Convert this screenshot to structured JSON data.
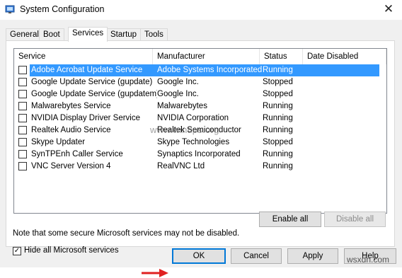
{
  "window": {
    "title": "System Configuration",
    "close_glyph": "✕"
  },
  "tabs": [
    {
      "label": "General"
    },
    {
      "label": "Boot"
    },
    {
      "label": "Services"
    },
    {
      "label": "Startup"
    },
    {
      "label": "Tools"
    }
  ],
  "active_tab": "Services",
  "table": {
    "headers": {
      "service": "Service",
      "manufacturer": "Manufacturer",
      "status": "Status",
      "date_disabled": "Date Disabled"
    },
    "rows": [
      {
        "service": "Adobe Acrobat Update Service",
        "manufacturer": "Adobe Systems Incorporated",
        "status": "Running",
        "date_disabled": "",
        "checked": false,
        "selected": true
      },
      {
        "service": "Google Update Service (gupdate)",
        "manufacturer": "Google Inc.",
        "status": "Stopped",
        "date_disabled": "",
        "checked": false,
        "selected": false
      },
      {
        "service": "Google Update Service (gupdatem)",
        "manufacturer": "Google Inc.",
        "status": "Stopped",
        "date_disabled": "",
        "checked": false,
        "selected": false
      },
      {
        "service": "Malwarebytes Service",
        "manufacturer": "Malwarebytes",
        "status": "Running",
        "date_disabled": "",
        "checked": false,
        "selected": false
      },
      {
        "service": "NVIDIA Display Driver Service",
        "manufacturer": "NVIDIA Corporation",
        "status": "Running",
        "date_disabled": "",
        "checked": false,
        "selected": false
      },
      {
        "service": "Realtek Audio Service",
        "manufacturer": "Realtek Semiconductor",
        "status": "Running",
        "date_disabled": "",
        "checked": false,
        "selected": false
      },
      {
        "service": "Skype Updater",
        "manufacturer": "Skype Technologies",
        "status": "Stopped",
        "date_disabled": "",
        "checked": false,
        "selected": false
      },
      {
        "service": "SynTPEnh Caller Service",
        "manufacturer": "Synaptics Incorporated",
        "status": "Running",
        "date_disabled": "",
        "checked": false,
        "selected": false
      },
      {
        "service": "VNC Server Version 4",
        "manufacturer": "RealVNC Ltd",
        "status": "Running",
        "date_disabled": "",
        "checked": false,
        "selected": false
      }
    ]
  },
  "note": "Note that some secure Microsoft services may not be disabled.",
  "buttons": {
    "enable_all": "Enable all",
    "disable_all": "Disable all",
    "ok": "OK",
    "cancel": "Cancel",
    "apply": "Apply",
    "help": "Help"
  },
  "hide_ms": {
    "label": "Hide all Microsoft services",
    "checked": true
  },
  "watermark": "www.wintips.org",
  "watermark_corner": "wsxdn.com",
  "colors": {
    "selection": "#3399ff",
    "focus_border": "#0078d7",
    "arrow": "#e02020"
  }
}
